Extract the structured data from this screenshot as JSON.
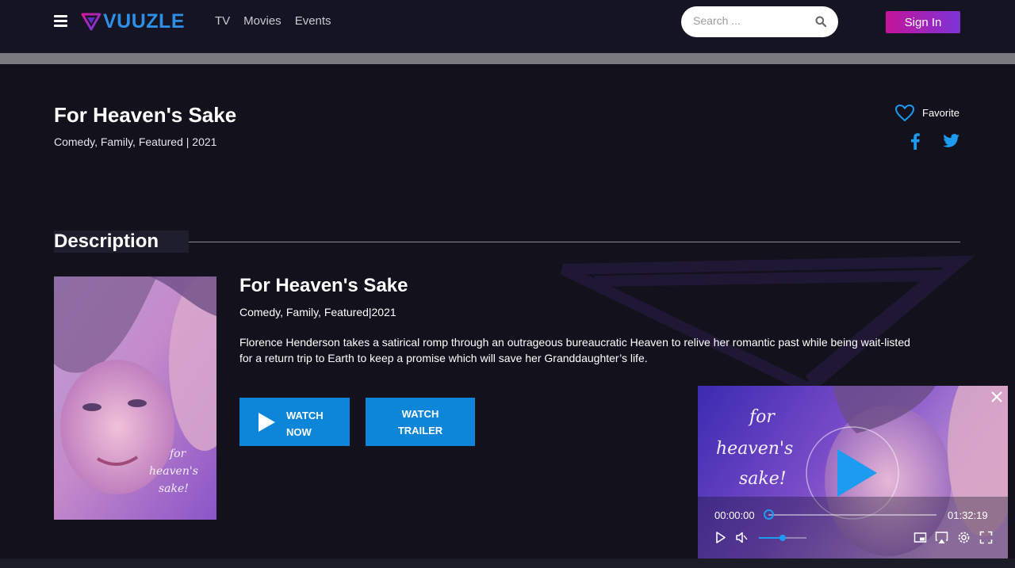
{
  "header": {
    "brand": "VUUZLE",
    "nav": [
      "TV",
      "Movies",
      "Events"
    ],
    "search_placeholder": "Search ...",
    "signin_label": "Sign In"
  },
  "movie": {
    "title": "For Heaven's Sake",
    "meta": "Comedy, Family, Featured | 2021",
    "favorite_label": "Favorite"
  },
  "description": {
    "heading": "Description",
    "title": "For Heaven's Sake",
    "meta": "Comedy, Family, Featured|2021",
    "synopsis": "Florence Henderson takes a satirical romp through an outrageous bureaucratic Heaven to relive her romantic past while being wait-listed for a return trip to Earth to keep a promise which will save her Granddaughter’s life.",
    "watch_now": "WATCH NOW",
    "watch_trailer": "WATCH TRAILER",
    "poster_text": "for heaven's sake!"
  },
  "player": {
    "current_time": "00:00:00",
    "duration": "01:32:19",
    "progress": 0,
    "volume": 0.5,
    "overlay_text": "for heaven's sake!"
  },
  "colors": {
    "accent": "#0d86d9",
    "brand": "#2f8fe6",
    "signin_gradient_start": "#c4149a",
    "signin_gradient_end": "#7d33d8",
    "background": "#12111c"
  },
  "icons": {
    "menu": "hamburger-icon",
    "search": "search-icon",
    "favorite": "heart-icon",
    "facebook": "facebook-icon",
    "twitter": "twitter-icon",
    "close": "close-icon"
  }
}
